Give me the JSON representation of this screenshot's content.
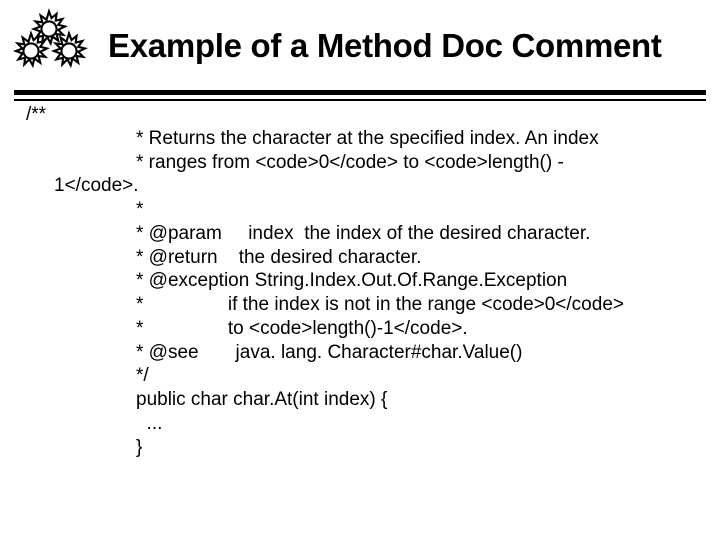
{
  "title": "Example of a Method Doc Comment",
  "code": {
    "l0": "/**",
    "l1": "* Returns the character at the specified index. An index",
    "l2": "* ranges from <code>0</code> to <code>length() -",
    "l3": "1</code>.",
    "l4": "*",
    "l5": "* @param     index  the index of the desired character.",
    "l6": "* @return    the desired character.",
    "l7": "* @exception String.Index.Out.Of.Range.Exception",
    "l8": "*                if the index is not in the range <code>0</code>",
    "l9": "*                to <code>length()-1</code>.",
    "l10": "* @see       java. lang. Character#char.Value()",
    "l11": "*/",
    "l12": "public char char.At(int index) {",
    "l13": "  ...",
    "l14": "}"
  }
}
